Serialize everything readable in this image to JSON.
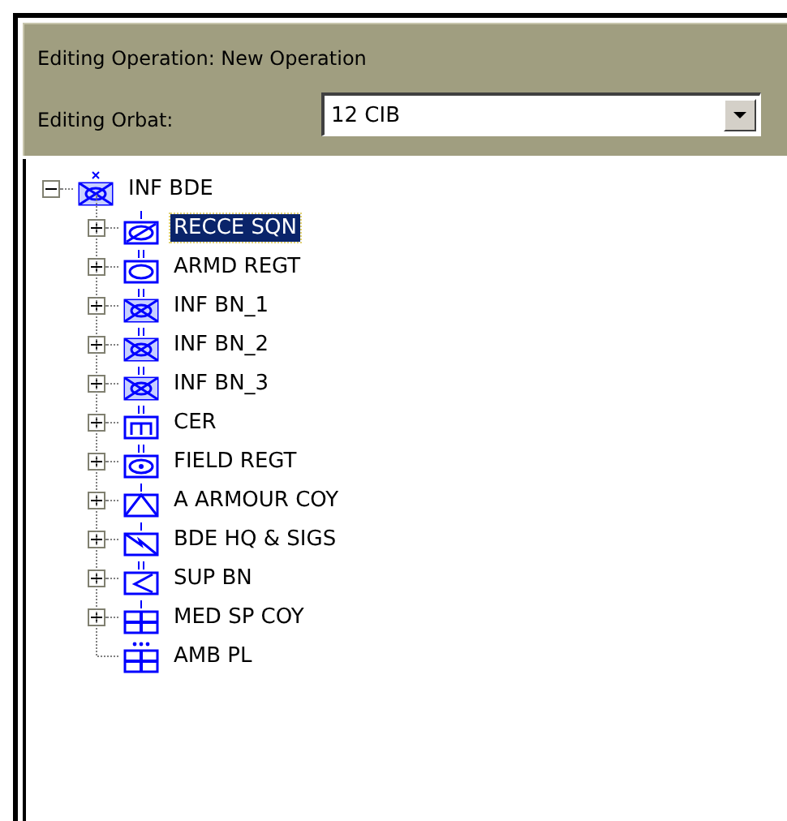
{
  "header": {
    "operation_label": "Editing Operation: New Operation",
    "orbat_label": "Editing Orbat:",
    "orbat_value": "12 CIB"
  },
  "tree": [
    {
      "label": "INF BDE",
      "kind": "infantry-brigade",
      "expanded": true,
      "selected": false,
      "children": [
        {
          "label": "RECCE SQN",
          "kind": "recce-company",
          "expanded": false,
          "selected": true
        },
        {
          "label": "ARMD REGT",
          "kind": "armour-battalion",
          "expanded": false,
          "selected": false
        },
        {
          "label": "INF BN_1",
          "kind": "infantry-battalion",
          "expanded": false,
          "selected": false
        },
        {
          "label": "INF BN_2",
          "kind": "infantry-battalion",
          "expanded": false,
          "selected": false
        },
        {
          "label": "INF BN_3",
          "kind": "infantry-battalion",
          "expanded": false,
          "selected": false
        },
        {
          "label": "CER",
          "kind": "engineer-battalion",
          "expanded": false,
          "selected": false
        },
        {
          "label": "FIELD REGT",
          "kind": "artillery-battalion",
          "expanded": false,
          "selected": false
        },
        {
          "label": "A ARMOUR COY",
          "kind": "antiarmour-company",
          "expanded": false,
          "selected": false
        },
        {
          "label": "BDE HQ & SIGS",
          "kind": "signals-company",
          "expanded": false,
          "selected": false
        },
        {
          "label": "SUP BN",
          "kind": "support-battalion",
          "expanded": false,
          "selected": false
        },
        {
          "label": "MED SP COY",
          "kind": "medical-company",
          "expanded": false,
          "selected": false
        },
        {
          "label": "AMB PL",
          "kind": "medical-platoon",
          "selected": false
        }
      ]
    }
  ]
}
